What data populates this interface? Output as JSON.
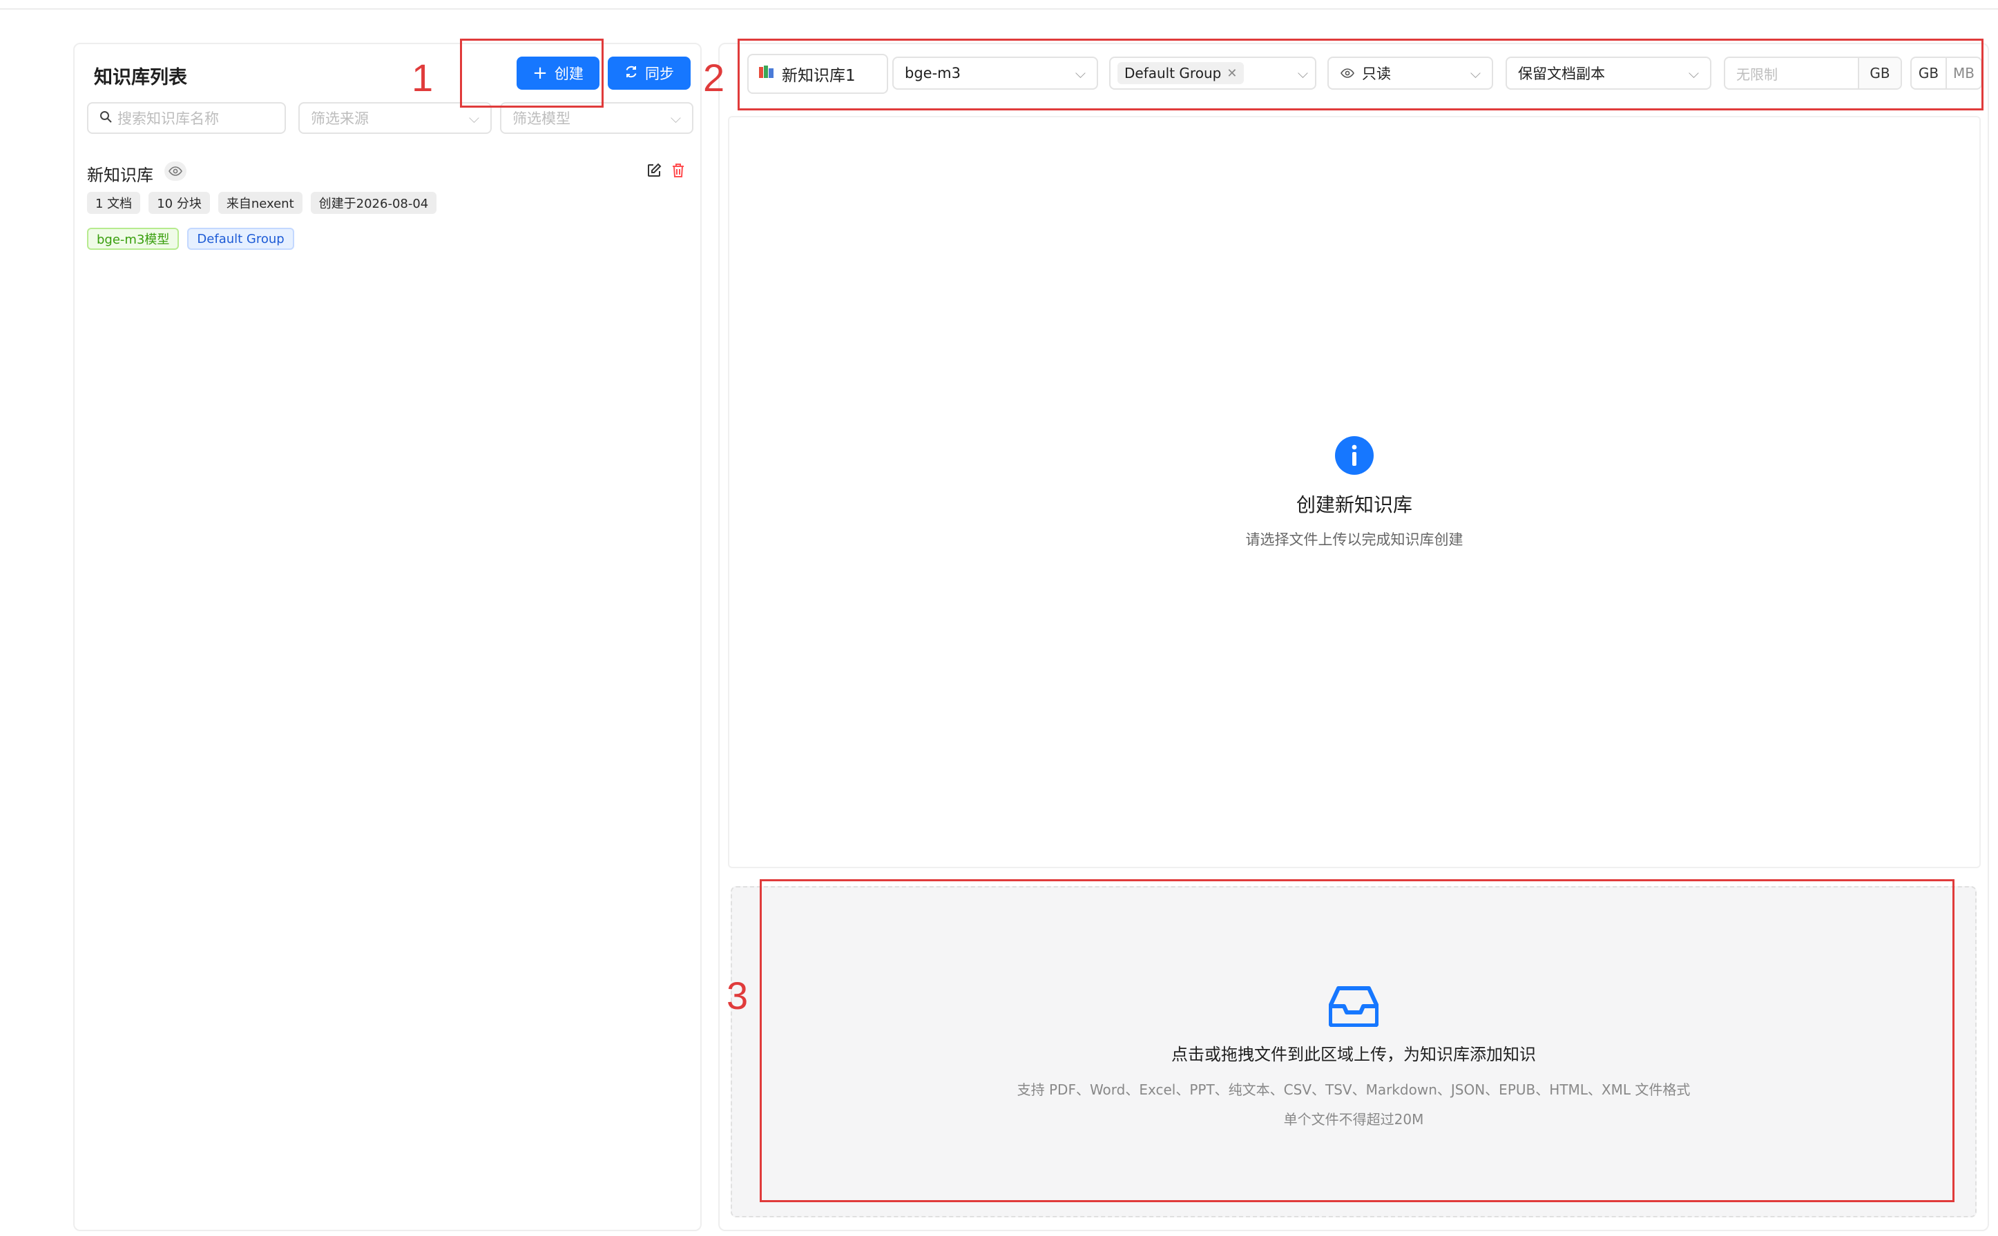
{
  "left_panel": {
    "title": "知识库列表",
    "create_label": "创建",
    "sync_label": "同步",
    "search_placeholder": "搜索知识库名称",
    "source_placeholder": "筛选来源",
    "model_placeholder": "筛选模型",
    "items": [
      {
        "name": "新知识库",
        "tags": [
          "1 文档",
          "10 分块",
          "来自nexent",
          "创建于2026-08-04"
        ],
        "model_tag": "bge-m3模型",
        "group_tag": "Default Group"
      }
    ]
  },
  "toolbar": {
    "kb_name": "新知识库1",
    "model": "bge-m3",
    "group": "Default Group",
    "permission": "只读",
    "retain": "保留文档副本",
    "size_placeholder": "无限制",
    "size_unit": "GB",
    "unit_options": [
      "GB",
      "MB"
    ]
  },
  "empty_state": {
    "title": "创建新知识库",
    "subtitle": "请选择文件上传以完成知识库创建"
  },
  "upload": {
    "title": "点击或拖拽文件到此区域上传，为知识库添加知识",
    "formats": "支持 PDF、Word、Excel、PPT、纯文本、CSV、TSV、Markdown、JSON、EPUB、HTML、XML 文件格式",
    "limit": "单个文件不得超过20M"
  },
  "annotations": [
    "1",
    "2",
    "3"
  ],
  "colors": {
    "primary": "#1677ff",
    "annotation": "#e03b3b",
    "danger": "#ff4d4f"
  }
}
